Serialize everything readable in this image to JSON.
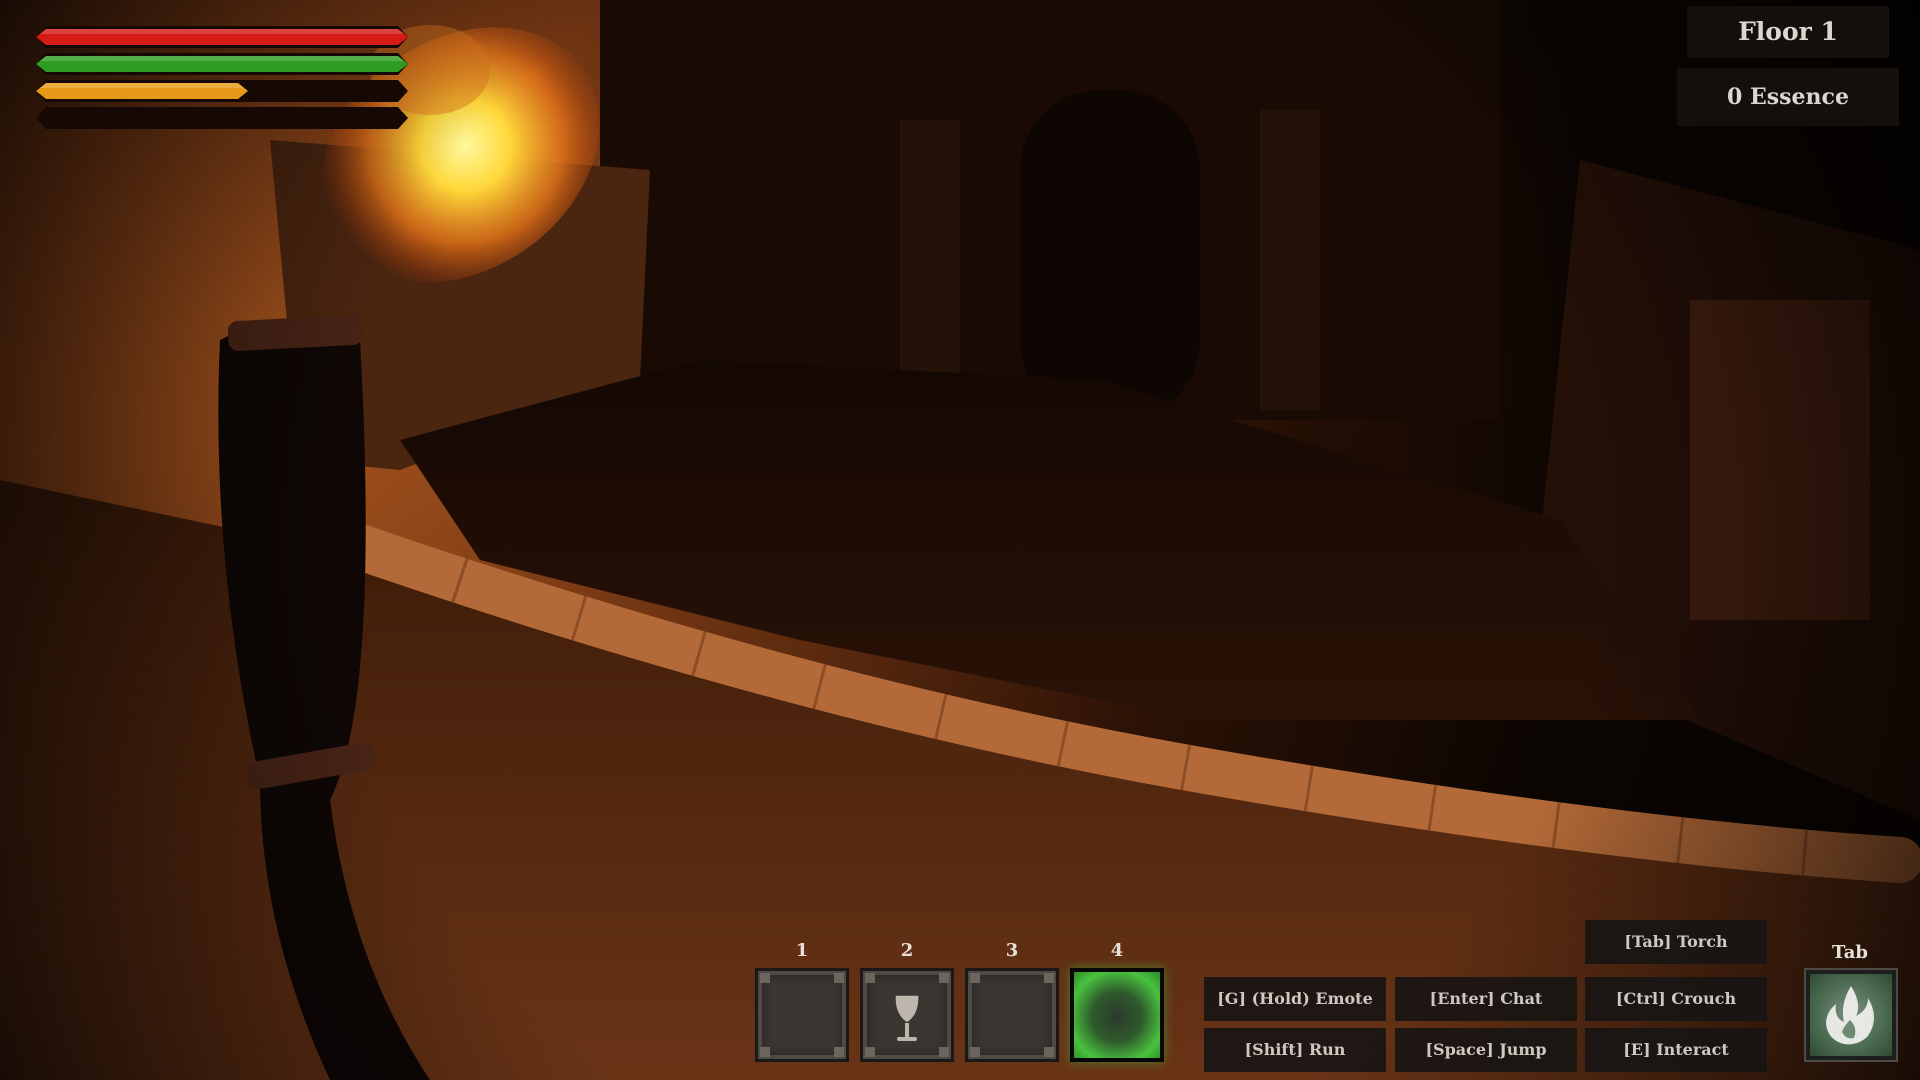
{
  "hud": {
    "bars": [
      {
        "name": "health",
        "fill": 1.0,
        "color": "#d41c14"
      },
      {
        "name": "stamina",
        "fill": 1.0,
        "color": "#2f9c22"
      },
      {
        "name": "torch-fuel",
        "fill": 0.57,
        "color": "#e69a18"
      },
      {
        "name": "empty",
        "fill": 0.0,
        "color": "#444444"
      }
    ],
    "floor_label": "Floor 1",
    "essence_label": "0 Essence"
  },
  "hotbar": {
    "slots": [
      {
        "number": "1",
        "item": "",
        "selected": false
      },
      {
        "number": "2",
        "item": "goblet-icon",
        "selected": false
      },
      {
        "number": "3",
        "item": "",
        "selected": false
      },
      {
        "number": "4",
        "item": "",
        "selected": true
      }
    ]
  },
  "keybinds": {
    "torch": "[Tab] Torch",
    "emote": "[G] (Hold) Emote",
    "chat": "[Enter] Chat",
    "crouch": "[Ctrl] Crouch",
    "run": "[Shift] Run",
    "jump": "[Space] Jump",
    "interact": "[E] Interact"
  },
  "ability": {
    "key_label": "Tab",
    "icon": "flame-icon"
  },
  "colors": {
    "accent_green": "#49c23e",
    "panel_bg": "#16100e",
    "text": "#dcd6cf"
  }
}
